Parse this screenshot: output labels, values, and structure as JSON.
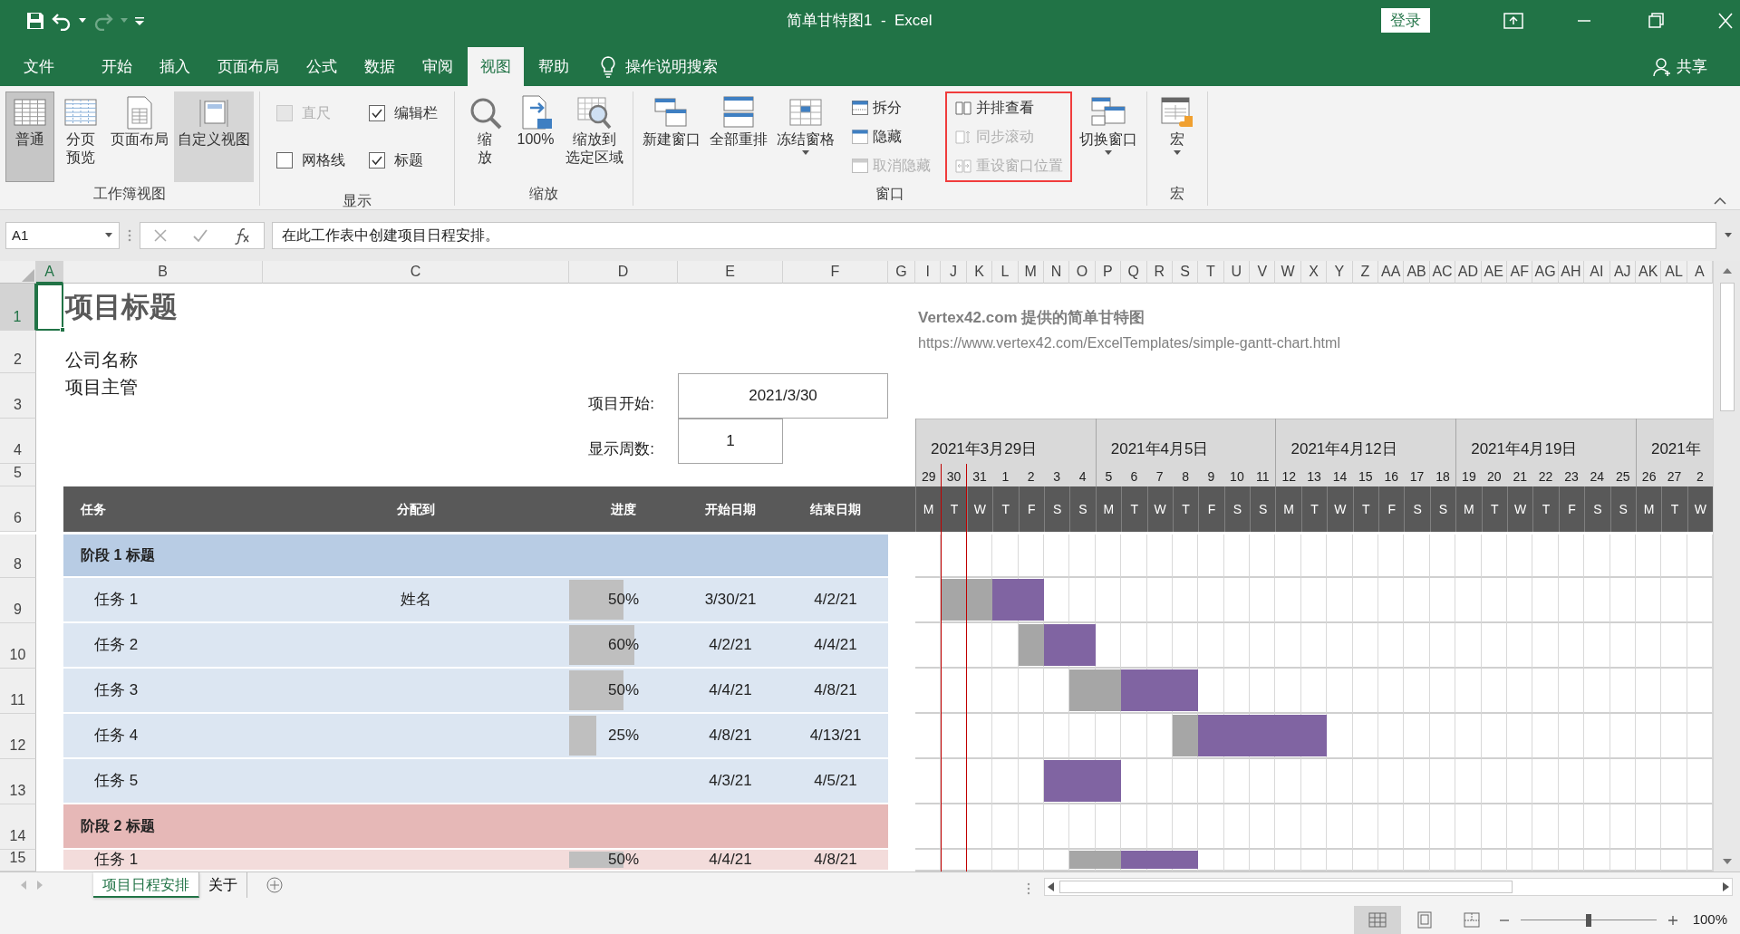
{
  "title_bar": {
    "title": "简单甘特图1  -  Excel",
    "sign_in": "登录"
  },
  "menu_tabs": [
    {
      "label": "文件",
      "selected": false
    },
    {
      "label": "开始",
      "selected": false
    },
    {
      "label": "插入",
      "selected": false
    },
    {
      "label": "页面布局",
      "selected": false
    },
    {
      "label": "公式",
      "selected": false
    },
    {
      "label": "数据",
      "selected": false
    },
    {
      "label": "审阅",
      "selected": false
    },
    {
      "label": "视图",
      "selected": true
    },
    {
      "label": "帮助",
      "selected": false
    }
  ],
  "tell_me": "操作说明搜索",
  "share": "共享",
  "ribbon": {
    "groups": [
      {
        "label": "工作簿视图",
        "items": [
          {
            "kind": "large",
            "label": "普通",
            "selected": true,
            "hovered": false,
            "dropdown": false
          },
          {
            "kind": "large",
            "lines": [
              "分页",
              "预览"
            ],
            "selected": false,
            "hovered": false,
            "dropdown": false
          },
          {
            "kind": "large",
            "label": "页面布局",
            "selected": false,
            "hovered": false,
            "dropdown": false
          },
          {
            "kind": "large",
            "label": "自定义视图",
            "selected": false,
            "hovered": true,
            "dropdown": false
          }
        ]
      },
      {
        "label": "显示",
        "items": [
          {
            "kind": "stack",
            "highlighted": false,
            "items": [
              {
                "kind": "check",
                "label": "直尺",
                "checked": false,
                "disabled": true
              },
              {
                "kind": "check",
                "label": "网格线",
                "checked": false,
                "disabled": false
              }
            ]
          },
          {
            "kind": "stack",
            "highlighted": false,
            "items": [
              {
                "kind": "check",
                "label": "编辑栏",
                "checked": true,
                "disabled": false
              },
              {
                "kind": "check",
                "label": "标题",
                "checked": true,
                "disabled": false
              }
            ]
          }
        ]
      },
      {
        "label": "缩放",
        "items": [
          {
            "kind": "large",
            "lines": [
              "缩",
              "放"
            ],
            "dropdown": false
          },
          {
            "kind": "large",
            "label": "100%",
            "dropdown": false
          },
          {
            "kind": "large",
            "lines": [
              "缩放到",
              "选定区域"
            ],
            "dropdown": false
          }
        ]
      },
      {
        "label": "窗口",
        "items": [
          {
            "kind": "large",
            "label": "新建窗口",
            "dropdown": false
          },
          {
            "kind": "large",
            "label": "全部重排",
            "dropdown": false
          },
          {
            "kind": "large",
            "label": "冻结窗格",
            "dropdown": true
          },
          {
            "kind": "stack",
            "highlighted": false,
            "items": [
              {
                "kind": "small",
                "label": "拆分",
                "disabled": false
              },
              {
                "kind": "small",
                "label": "隐藏",
                "disabled": false
              },
              {
                "kind": "small",
                "label": "取消隐藏",
                "disabled": true
              }
            ]
          },
          {
            "kind": "stack",
            "highlighted": true,
            "items": [
              {
                "kind": "small",
                "label": "并排查看",
                "disabled": false
              },
              {
                "kind": "small",
                "label": "同步滚动",
                "disabled": true
              },
              {
                "kind": "small",
                "label": "重设窗口位置",
                "disabled": true
              }
            ]
          },
          {
            "kind": "large",
            "label": "切换窗口",
            "dropdown": true
          }
        ]
      },
      {
        "label": "宏",
        "items": [
          {
            "kind": "large",
            "label": "宏",
            "dropdown": true
          }
        ]
      }
    ]
  },
  "formula_bar": {
    "name_box": "A1",
    "formula": "在此工作表中创建项目日程安排。"
  },
  "column_headers": [
    {
      "label": "A",
      "selected": true
    },
    {
      "label": "B",
      "selected": false
    },
    {
      "label": "C",
      "selected": false
    },
    {
      "label": "D",
      "selected": false
    },
    {
      "label": "E",
      "selected": false
    },
    {
      "label": "F",
      "selected": false
    },
    {
      "label": "G",
      "selected": false
    },
    {
      "label": "I",
      "selected": false
    },
    {
      "label": "J",
      "selected": false
    },
    {
      "label": "K",
      "selected": false
    },
    {
      "label": "L",
      "selected": false
    },
    {
      "label": "M",
      "selected": false
    },
    {
      "label": "N",
      "selected": false
    },
    {
      "label": "O",
      "selected": false
    },
    {
      "label": "P",
      "selected": false
    },
    {
      "label": "Q",
      "selected": false
    },
    {
      "label": "R",
      "selected": false
    },
    {
      "label": "S",
      "selected": false
    },
    {
      "label": "T",
      "selected": false
    },
    {
      "label": "U",
      "selected": false
    },
    {
      "label": "V",
      "selected": false
    },
    {
      "label": "W",
      "selected": false
    },
    {
      "label": "X",
      "selected": false
    },
    {
      "label": "Y",
      "selected": false
    },
    {
      "label": "Z",
      "selected": false
    },
    {
      "label": "AA",
      "selected": false
    },
    {
      "label": "AB",
      "selected": false
    },
    {
      "label": "AC",
      "selected": false
    },
    {
      "label": "AD",
      "selected": false
    },
    {
      "label": "AE",
      "selected": false
    },
    {
      "label": "AF",
      "selected": false
    },
    {
      "label": "AG",
      "selected": false
    },
    {
      "label": "AH",
      "selected": false
    },
    {
      "label": "AI",
      "selected": false
    },
    {
      "label": "AJ",
      "selected": false
    },
    {
      "label": "AK",
      "selected": false
    },
    {
      "label": "AL",
      "selected": false
    },
    {
      "label": "A",
      "selected": false
    }
  ],
  "row_headers": [
    {
      "label": "1",
      "selected": true
    },
    {
      "label": "2",
      "selected": false
    },
    {
      "label": "3",
      "selected": false
    },
    {
      "label": "4",
      "selected": false
    },
    {
      "label": "5",
      "selected": false
    },
    {
      "label": "6",
      "selected": false
    },
    {
      "label": "8",
      "selected": false
    },
    {
      "label": "9",
      "selected": false
    },
    {
      "label": "10",
      "selected": false
    },
    {
      "label": "11",
      "selected": false
    },
    {
      "label": "12",
      "selected": false
    },
    {
      "label": "13",
      "selected": false
    },
    {
      "label": "14",
      "selected": false
    },
    {
      "label": "15",
      "selected": false
    }
  ],
  "project": {
    "title": "项目标题",
    "company": "公司名称",
    "manager": "项目主管",
    "start_label": "项目开始:",
    "start_value": "2021/3/30",
    "weeks_label": "显示周数:",
    "weeks_value": "1",
    "credit": "Vertex42.com 提供的简单甘特图",
    "url": "https://www.vertex42.com/ExcelTemplates/simple-gantt-chart.html"
  },
  "task_columns": [
    "任务",
    "分配到",
    "进度",
    "开始日期",
    "结束日期"
  ],
  "timeline": {
    "weeks": [
      "2021年3月29日",
      "2021年4月5日",
      "2021年4月12日",
      "2021年4月19日",
      "2021年"
    ],
    "days": [
      {
        "day": "29",
        "weekday": "M"
      },
      {
        "day": "30",
        "weekday": "T"
      },
      {
        "day": "31",
        "weekday": "W"
      },
      {
        "day": "1",
        "weekday": "T"
      },
      {
        "day": "2",
        "weekday": "F"
      },
      {
        "day": "3",
        "weekday": "S"
      },
      {
        "day": "4",
        "weekday": "S"
      },
      {
        "day": "5",
        "weekday": "M"
      },
      {
        "day": "6",
        "weekday": "T"
      },
      {
        "day": "7",
        "weekday": "W"
      },
      {
        "day": "8",
        "weekday": "T"
      },
      {
        "day": "9",
        "weekday": "F"
      },
      {
        "day": "10",
        "weekday": "S"
      },
      {
        "day": "11",
        "weekday": "S"
      },
      {
        "day": "12",
        "weekday": "M"
      },
      {
        "day": "13",
        "weekday": "T"
      },
      {
        "day": "14",
        "weekday": "W"
      },
      {
        "day": "15",
        "weekday": "T"
      },
      {
        "day": "16",
        "weekday": "F"
      },
      {
        "day": "17",
        "weekday": "S"
      },
      {
        "day": "18",
        "weekday": "S"
      },
      {
        "day": "19",
        "weekday": "M"
      },
      {
        "day": "20",
        "weekday": "T"
      },
      {
        "day": "21",
        "weekday": "W"
      },
      {
        "day": "22",
        "weekday": "T"
      },
      {
        "day": "23",
        "weekday": "F"
      },
      {
        "day": "24",
        "weekday": "S"
      },
      {
        "day": "25",
        "weekday": "S"
      },
      {
        "day": "26",
        "weekday": "M"
      },
      {
        "day": "27",
        "weekday": "T"
      },
      {
        "day": "2",
        "weekday": "W"
      }
    ]
  },
  "phases": [
    {
      "title": "阶段 1 标题",
      "color": "#b8cce4",
      "tasks": [
        {
          "name": "任务 1",
          "assignee": "姓名",
          "progress": "50%",
          "level": 0.5,
          "start": "3/30/21",
          "end": "4/2/21"
        },
        {
          "name": "任务 2",
          "progress": "60%",
          "level": 0.6,
          "start": "4/2/21",
          "end": "4/4/21"
        },
        {
          "name": "任务 3",
          "progress": "50%",
          "level": 0.5,
          "start": "4/4/21",
          "end": "4/8/21"
        },
        {
          "name": "任务 4",
          "progress": "25%",
          "level": 0.25,
          "start": "4/8/21",
          "end": "4/13/21"
        },
        {
          "name": "任务 5",
          "start": "4/3/21",
          "end": "4/5/21"
        }
      ]
    },
    {
      "title": "阶段 2 标题",
      "color": "#e6b8b7",
      "tasks": [
        {
          "name": "任务 1",
          "progress": "50%",
          "level": 0.5,
          "start": "4/4/21",
          "end": "4/8/21"
        }
      ]
    }
  ],
  "sheet_tabs": [
    {
      "label": "项目日程安排",
      "selected": true
    },
    {
      "label": "关于",
      "selected": false
    }
  ],
  "status_bar": {
    "views": [
      {
        "selected": true
      },
      {
        "selected": false
      },
      {
        "selected": false
      }
    ],
    "zoom_slider": {
      "level": 0.5
    },
    "zoom": "100%"
  }
}
